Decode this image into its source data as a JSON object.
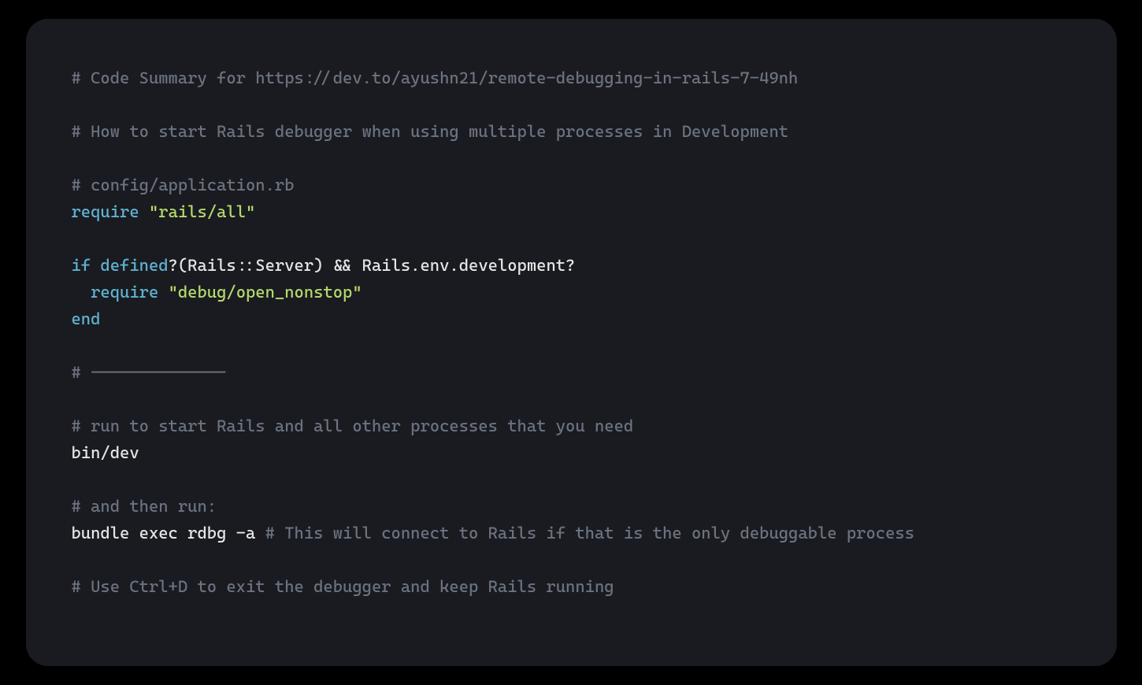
{
  "colors": {
    "bg_outer": "#000000",
    "bg_card": "#1a1b20",
    "comment": "#6b7280",
    "keyword": "#5fb3d2",
    "string": "#b5d96c",
    "plain": "#e6e6e6"
  },
  "code": {
    "lines": [
      [
        {
          "c": "comment",
          "t": "# Code Summary for https://dev.to/ayushn21/remote-debugging-in-rails-7-49nh"
        }
      ],
      [],
      [
        {
          "c": "comment",
          "t": "# How to start Rails debugger when using multiple processes in Development"
        }
      ],
      [],
      [
        {
          "c": "comment",
          "t": "# config/application.rb"
        }
      ],
      [
        {
          "c": "keyword",
          "t": "require"
        },
        {
          "c": "plain",
          "t": " "
        },
        {
          "c": "string",
          "t": "\"rails/all\""
        }
      ],
      [],
      [
        {
          "c": "keyword",
          "t": "if"
        },
        {
          "c": "plain",
          "t": " "
        },
        {
          "c": "builtin",
          "t": "defined"
        },
        {
          "c": "plain",
          "t": "?(Rails::Server) && Rails.env.development?"
        }
      ],
      [
        {
          "c": "plain",
          "t": "  "
        },
        {
          "c": "keyword",
          "t": "require"
        },
        {
          "c": "plain",
          "t": " "
        },
        {
          "c": "string",
          "t": "\"debug/open_nonstop\""
        }
      ],
      [
        {
          "c": "keyword",
          "t": "end"
        }
      ],
      [],
      [
        {
          "c": "comment",
          "t": "# --------------"
        }
      ],
      [],
      [
        {
          "c": "comment",
          "t": "# run to start Rails and all other processes that you need"
        }
      ],
      [
        {
          "c": "plain",
          "t": "bin/dev"
        }
      ],
      [],
      [
        {
          "c": "comment",
          "t": "# and then run:"
        }
      ],
      [
        {
          "c": "plain",
          "t": "bundle exec rdbg -a "
        },
        {
          "c": "comment",
          "t": "# This will connect to Rails if that is the only debuggable process"
        }
      ],
      [],
      [
        {
          "c": "comment",
          "t": "# Use Ctrl+D to exit the debugger and keep Rails running"
        }
      ]
    ]
  }
}
